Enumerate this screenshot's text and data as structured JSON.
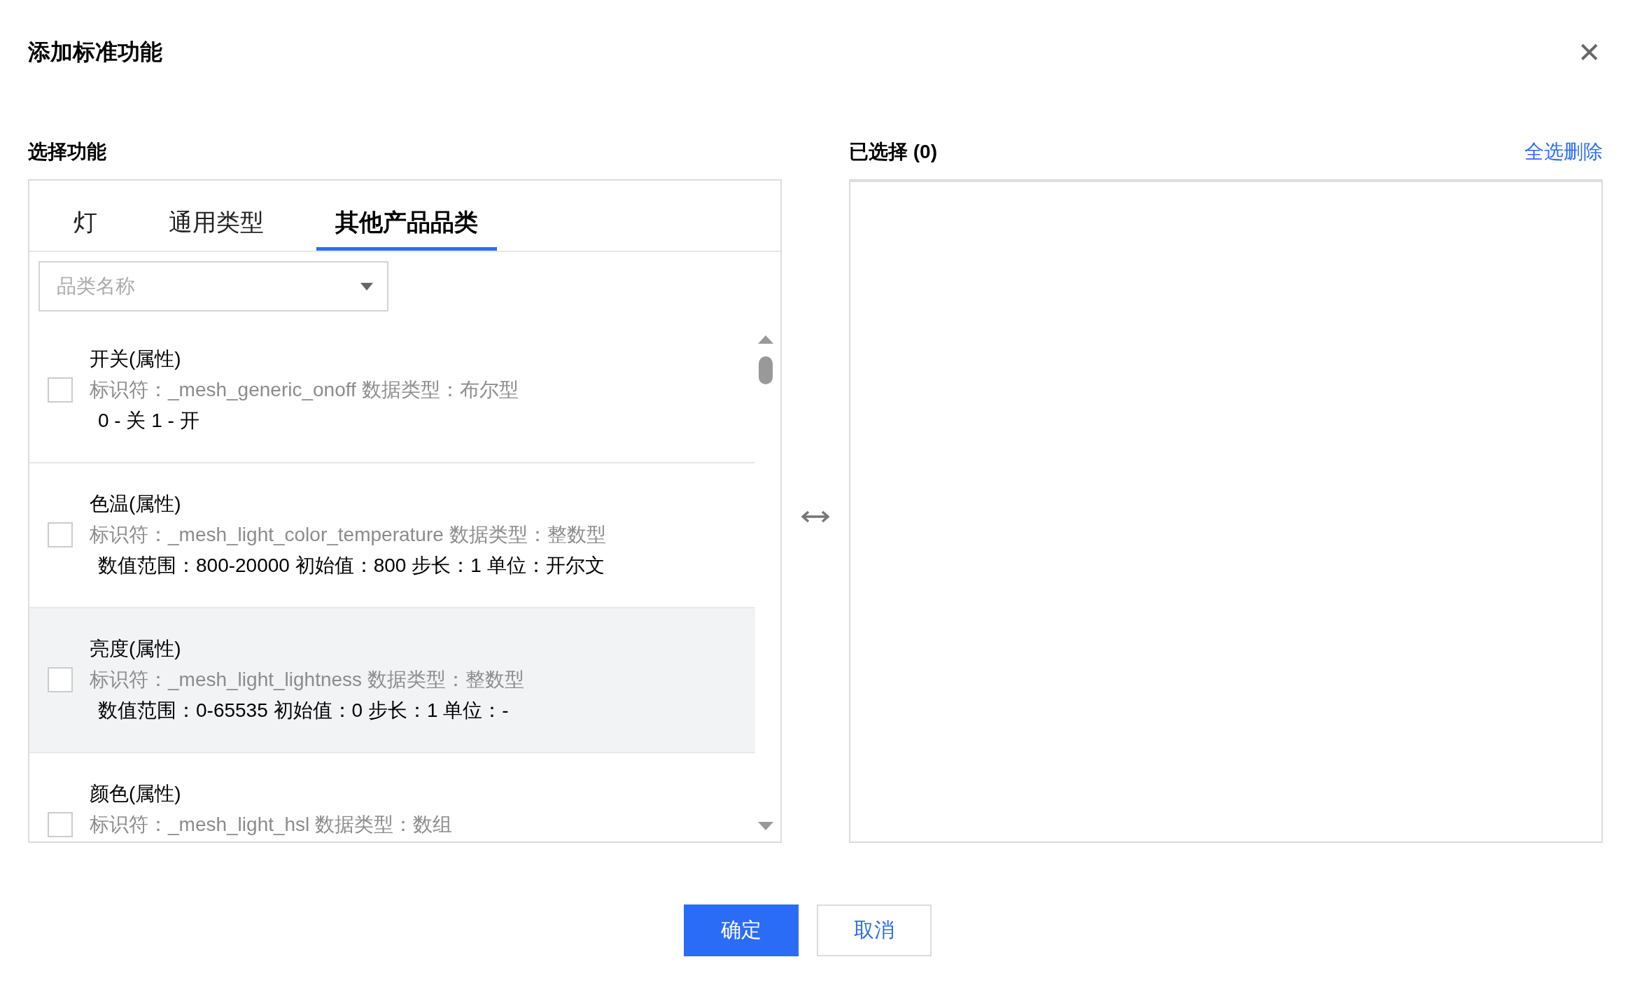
{
  "dialog": {
    "title": "添加标准功能",
    "close": "✕"
  },
  "left": {
    "heading": "选择功能",
    "tabs": [
      {
        "label": "灯",
        "selected": false
      },
      {
        "label": "通用类型",
        "selected": false
      },
      {
        "label": "其他产品品类",
        "selected": true
      }
    ],
    "category_select": {
      "placeholder": "品类名称"
    },
    "items": [
      {
        "name": "开关(属性)",
        "identifier": "标识符：_mesh_generic_onoff 数据类型：布尔型",
        "detail": "0 - 关 1 - 开",
        "checked": false,
        "hovered": false
      },
      {
        "name": "色温(属性)",
        "identifier": "标识符：_mesh_light_color_temperature 数据类型：整数型",
        "detail": "数值范围：800-20000 初始值：800 步长：1 单位：开尔文",
        "checked": false,
        "hovered": false
      },
      {
        "name": "亮度(属性)",
        "identifier": "标识符：_mesh_light_lightness 数据类型：整数型",
        "detail": "数值范围：0-65535 初始值：0 步长：1 单位：-",
        "checked": false,
        "hovered": true
      },
      {
        "name": "颜色(属性)",
        "identifier": "标识符：_mesh_light_hsl 数据类型：数组",
        "checked": false,
        "hovered": false
      }
    ]
  },
  "right": {
    "heading": "已选择 (0)",
    "clear_all": "全选删除"
  },
  "buttons": [
    {
      "label": "确定",
      "kind": "primary"
    },
    {
      "label": "取消",
      "kind": "secondary"
    }
  ]
}
